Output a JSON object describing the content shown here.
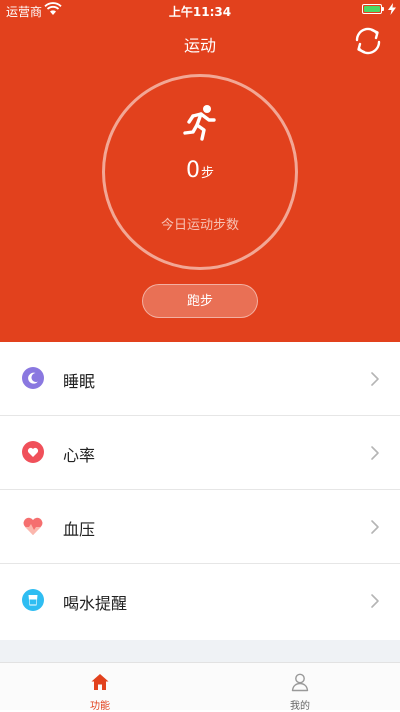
{
  "status_bar": {
    "carrier": "运营商",
    "time": "上午11:34",
    "battery_color": "#4cd964"
  },
  "nav": {
    "title": "运动",
    "refresh_icon": "refresh-icon"
  },
  "summary": {
    "steps_value": "0",
    "steps_unit": "步",
    "caption": "今日运动步数",
    "run_button_label": "跑步",
    "runner_icon": "running-man-icon"
  },
  "list": {
    "items": [
      {
        "label": "睡眠",
        "icon": "moon-icon",
        "color": "#8a78e0"
      },
      {
        "label": "心率",
        "icon": "heart-icon",
        "color": "#f0505a"
      },
      {
        "label": "血压",
        "icon": "heart-pressure-icon",
        "color": "#f56f6f"
      },
      {
        "label": "喝水提醒",
        "icon": "water-cup-icon",
        "color": "#2fbdf2"
      }
    ]
  },
  "tabbar": {
    "tabs": [
      {
        "label": "功能",
        "icon": "home-icon",
        "active": true
      },
      {
        "label": "我的",
        "icon": "user-icon",
        "active": false
      }
    ]
  },
  "colors": {
    "primary": "#e2411d",
    "tab_active": "#e2411d",
    "tab_inactive": "#999999"
  }
}
